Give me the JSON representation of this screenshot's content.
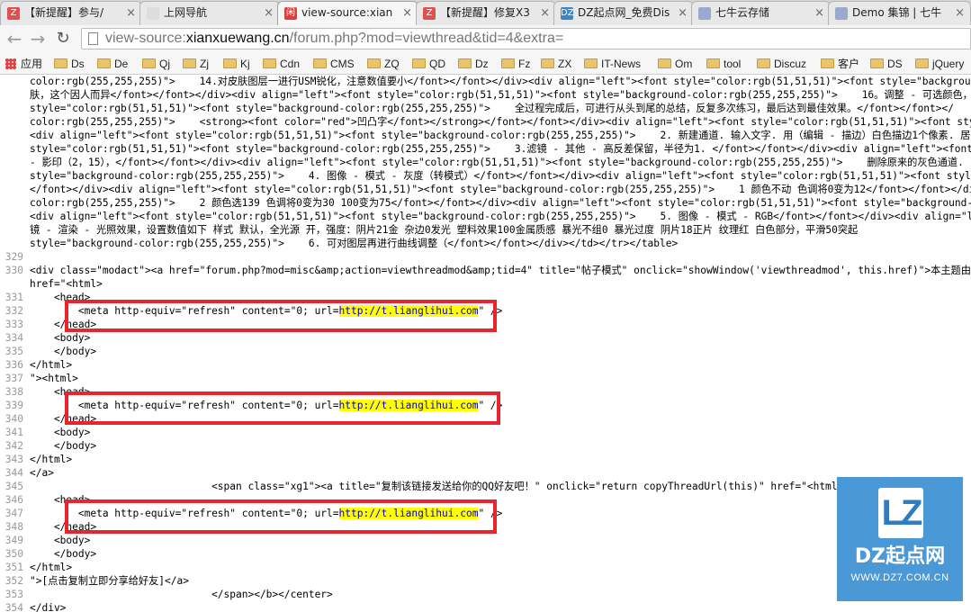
{
  "tabs": [
    {
      "label": "【新提醒】参与/",
      "favicon": "Z",
      "color": "#e05050"
    },
    {
      "label": "上网导航",
      "favicon": "",
      "color": "#dddddd"
    },
    {
      "label": "view-source:xian",
      "favicon": "闲",
      "color": "#e03c3c"
    },
    {
      "label": "【新提醒】修复X3",
      "favicon": "Z",
      "color": "#e05050"
    },
    {
      "label": "DZ起点网_免费Dis",
      "favicon": "DZ",
      "color": "#3a86c8"
    },
    {
      "label": "七牛云存储",
      "favicon": "",
      "color": "#9ac"
    },
    {
      "label": "Demo 集锦 | 七牛",
      "favicon": "",
      "color": "#9ac"
    }
  ],
  "address": {
    "prefix": "view-source:",
    "host": "xianxuewang.cn",
    "path": "/forum.php?mod=viewthread&tid=4&extra="
  },
  "bookmarks": [
    "应用",
    "Ds",
    "De",
    "Qj",
    "Zj",
    "Kj",
    "Cdn",
    "CMS",
    "ZQ",
    "QD",
    "Dz",
    "Fz",
    "ZX",
    "IT-News",
    "Om",
    "tool",
    "Discuz",
    "客户",
    "DS",
    "jQuery"
  ],
  "code_lines": [
    {
      "n": "",
      "t": "color:rgb(255,255,255)\">    14.对皮肤图层一进行USM锐化，注意数值要小</font></font></div><div align=\"left\"><font style=\"color:rgb(51,51,51)\"><font style=\"backgrou"
    },
    {
      "n": "",
      "t": "肤，这个因人而异</font></font></div><div align=\"left\"><font style=\"color:rgb(51,51,51)\"><font style=\"background-color:rgb(255,255,255)\">    16。调整 - 可选颜色，"
    },
    {
      "n": "",
      "t": "style=\"color:rgb(51,51,51)\"><font style=\"background-color:rgb(255,255,255)\">    全过程完成后，可进行从头到尾的总结，反复多次练习，最后达到最佳效果。</font></font></"
    },
    {
      "n": "",
      "t": "color:rgb(255,255,255)\">    <strong><font color=\"red\">凹凸字</font></strong></font></font></div><div align=\"left\"><font style=\"color:rgb(51,51,51)\"><font style="
    },
    {
      "n": "",
      "t": "<div align=\"left\"><font style=\"color:rgb(51,51,51)\"><font style=\"background-color:rgb(255,255,255)\">    2. 新建通道. 输入文字. 用（编辑 - 描边）白色描边1个像素. 居"
    },
    {
      "n": "",
      "t": "style=\"color:rgb(51,51,51)\"><font style=\"background-color:rgb(255,255,255)\">    3.滤镜 - 其他 - 高反差保留，半径为1. </font></font></div><div align=\"left\"><font st"
    },
    {
      "n": "",
      "t": "- 影印（2，15），</font></font></div><div align=\"left\"><font style=\"color:rgb(51,51,51)\"><font style=\"background-color:rgb(255,255,255)\">    删除原来的灰色通道."
    },
    {
      "n": "",
      "t": "style=\"background-color:rgb(255,255,255)\">    4. 图像 - 模式 - 灰度（转模式）</font></font></div><div align=\"left\"><font style=\"color:rgb(51,51,51)\"><font style=\"b"
    },
    {
      "n": "",
      "t": "</font></div><div align=\"left\"><font style=\"color:rgb(51,51,51)\"><font style=\"background-color:rgb(255,255,255)\">    1 颜色不动 色调将0变为12</font></font></div><d"
    },
    {
      "n": "",
      "t": "color:rgb(255,255,255)\">    2 颜色选139 色调将0变为30 100变为75</font></font></div><div align=\"left\"><font style=\"color:rgb(51,51,51)\"><font style=\"background-"
    },
    {
      "n": "",
      "t": "<div align=\"left\"><font style=\"color:rgb(51,51,51)\"><font style=\"background-color:rgb(255,255,255)\">    5. 图像 - 模式 - RGB</font></font></div><div align=\"left\"><"
    },
    {
      "n": "",
      "t": "镜 - 渲染 - 光照效果，设置数值如下 样式 默认，全光源 开，强度：阴片21金 杂边0发光 塑料效果100金属质感 暴光不组0 暴光过度 阴片18正片 纹理红 白色部分，平滑50突起"
    },
    {
      "n": "",
      "t": "style=\"background-color:rgb(255,255,255)\">    6. 可对图层再进行曲线调整（</font></font></div></td></tr></table>"
    },
    {
      "n": "329",
      "t": ""
    },
    {
      "n": "330",
      "t": "<div class=\"modact\"><a href=\"forum.php?mod=misc&amp;action=viewthreadmod&amp;tid=4\" title=\"帖子模式\" onclick=\"showWindow('viewthreadmod', this.href)\">本主题由 xi"
    },
    {
      "n": "",
      "t": "href=\"<html>"
    },
    {
      "n": "331",
      "t": "    <head>"
    },
    {
      "n": "332",
      "t": "        <meta http-equiv=\"refresh\" content=\"0; url=",
      "hl": "http://t.lianglihui.com",
      "after": "\" />"
    },
    {
      "n": "333",
      "t": "    </head>"
    },
    {
      "n": "334",
      "t": "    <body>"
    },
    {
      "n": "335",
      "t": "    </body>"
    },
    {
      "n": "336",
      "t": "</html>"
    },
    {
      "n": "337",
      "t": "\"><html>"
    },
    {
      "n": "338",
      "t": "    <head>"
    },
    {
      "n": "339",
      "t": "        <meta http-equiv=\"refresh\" content=\"0; url=",
      "hl": "http://t.lianglihui.com",
      "after": "\" />"
    },
    {
      "n": "340",
      "t": "    </head>"
    },
    {
      "n": "341",
      "t": "    <body>"
    },
    {
      "n": "342",
      "t": "    </body>"
    },
    {
      "n": "343",
      "t": "</html>"
    },
    {
      "n": "344",
      "t": "</a>"
    },
    {
      "n": "345",
      "t": "                              <span class=\"xg1\"><a title=\"复制该链接发送给你的QQ好友吧！\" onclick=\"return copyThreadUrl(this)\" href=\"<html>"
    },
    {
      "n": "346",
      "t": "    <head>"
    },
    {
      "n": "347",
      "t": "        <meta http-equiv=\"refresh\" content=\"0; url=",
      "hl": "http://t.lianglihui.com",
      "after": "\" />"
    },
    {
      "n": "348",
      "t": "    </head>"
    },
    {
      "n": "349",
      "t": "    <body>"
    },
    {
      "n": "350",
      "t": "    </body>"
    },
    {
      "n": "351",
      "t": "</html>"
    },
    {
      "n": "352",
      "t": "\">[点击复制立即分享给好友]</a>"
    },
    {
      "n": "353",
      "t": "                              </span></b></center>"
    },
    {
      "n": "354",
      "t": "</div>"
    }
  ],
  "logo": {
    "mark": "LZ",
    "name": "DZ起点网",
    "site": "WWW.DZ7.COM.CN"
  },
  "colors": {
    "highlight": "#ffff00",
    "box": "#e8242c",
    "logo_bg": "#4b98d6"
  }
}
